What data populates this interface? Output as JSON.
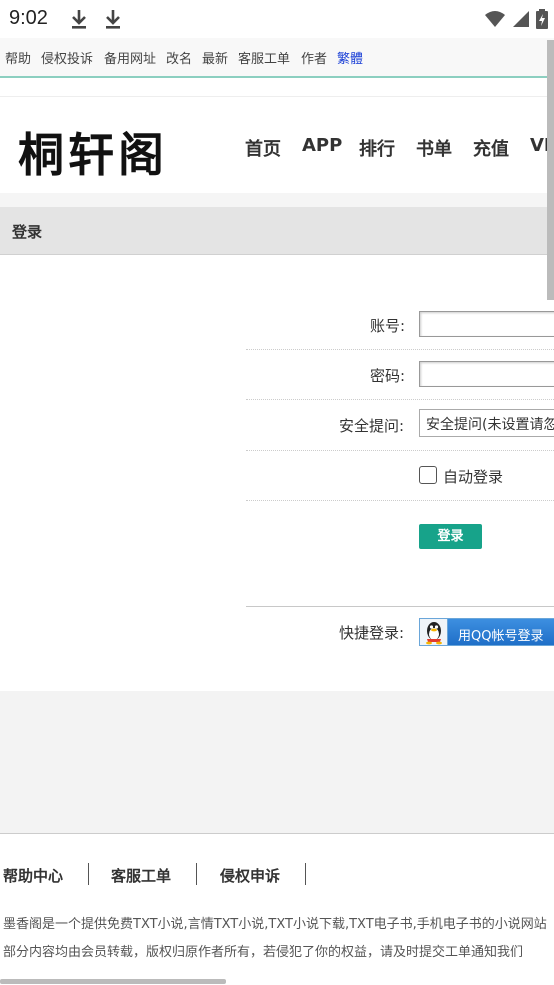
{
  "status_bar": {
    "time": "9:02",
    "icons": [
      "download-icon",
      "download-icon",
      "wifi-icon",
      "signal-icon",
      "battery-icon"
    ]
  },
  "top_links": {
    "items": [
      "帮助",
      "侵权投诉",
      "备用网址",
      "改名",
      "最新",
      "客服工单",
      "作者"
    ],
    "traditional": "繁體"
  },
  "header": {
    "logo": "桐轩阁",
    "nav": [
      "首页",
      "APP",
      "排行",
      "书单",
      "充值",
      "VIP"
    ]
  },
  "login_panel": {
    "title": "登录",
    "account_label": "账号:",
    "account_value": "",
    "password_label": "密码:",
    "password_value": "",
    "question_label": "安全提问:",
    "question_selected": "安全提问(未设置请忽略)",
    "auto_login_label": "自动登录",
    "login_button": "登录",
    "quick_login_label": "快捷登录:",
    "qq_button": "用QQ帐号登录"
  },
  "footer": {
    "links": [
      "帮助中心",
      "客服工单",
      "侵权申诉"
    ],
    "line1": "墨香阁是一个提供免费TXT小说,言情TXT小说,TXT小说下载,TXT电子书,手机电子书的小说网站",
    "line2": "部分内容均由会员转载，版权归原作者所有，若侵犯了你的权益，请及时提交工单通知我们"
  },
  "colors": {
    "accent": "#17a38a",
    "traditional_link": "#1a3fd6",
    "qq_blue": "#1f6fc8"
  }
}
